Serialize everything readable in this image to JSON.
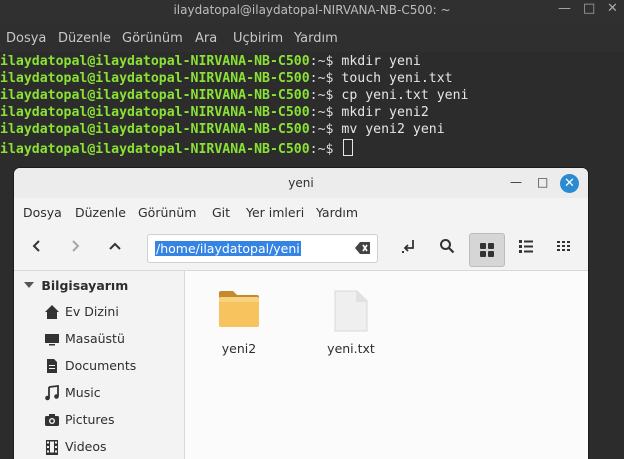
{
  "terminal": {
    "title": "ilaydatopal@ilaydatopal-NIRVANA-NB-C500: ~",
    "menu": [
      "Dosya",
      "Düzenle",
      "Görünüm",
      "Ara",
      "Uçbirim",
      "Yardım"
    ],
    "prompt": "ilaydatopal@ilaydatopal-NIRVANA-NB-C500",
    "suffix": ":~$ ",
    "lines": [
      {
        "cmd": "mkdir yeni"
      },
      {
        "cmd": "touch yeni.txt"
      },
      {
        "cmd": "cp yeni.txt yeni"
      },
      {
        "cmd": "mkdir yeni2"
      },
      {
        "cmd": "mv yeni2 yeni"
      },
      {
        "cmd": ""
      }
    ]
  },
  "filemanager": {
    "title": "yeni",
    "menu": [
      "Dosya",
      "Düzenle",
      "Görünüm",
      "Git",
      "Yer imleri",
      "Yardım"
    ],
    "path": "/home/ilaydatopal/yeni",
    "sidebar": {
      "section": "Bilgisayarım",
      "items": [
        {
          "label": "Ev Dizini",
          "icon": "home-icon"
        },
        {
          "label": "Masaüstü",
          "icon": "desktop-icon"
        },
        {
          "label": "Documents",
          "icon": "documents-icon"
        },
        {
          "label": "Music",
          "icon": "music-icon"
        },
        {
          "label": "Pictures",
          "icon": "camera-icon"
        },
        {
          "label": "Videos",
          "icon": "film-icon"
        }
      ]
    },
    "files": [
      {
        "name": "yeni2",
        "type": "folder"
      },
      {
        "name": "yeni.txt",
        "type": "text"
      }
    ],
    "colors": {
      "accent": "#3584e4",
      "folder": "#f6c35f",
      "prompt": "#8ae234",
      "close": "#2a8bd0"
    }
  }
}
